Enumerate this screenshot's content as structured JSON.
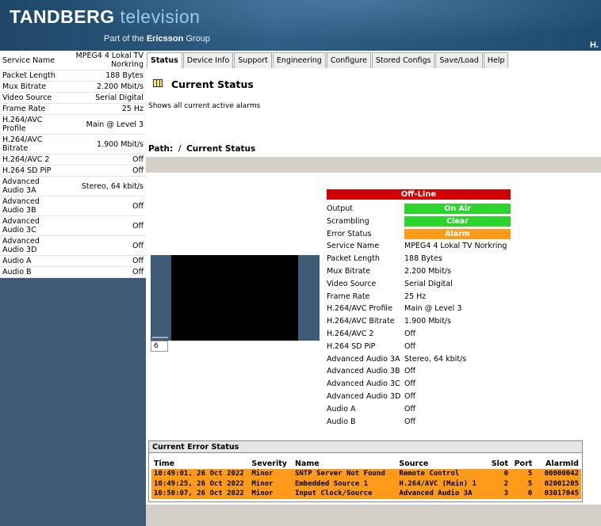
{
  "header": {
    "logo_bold": "TANDBERG",
    "logo_light": " television",
    "tagline_prefix": "Part of the",
    "tagline_company": "Ericsson",
    "tagline_suffix": "Group",
    "corner_text": "H."
  },
  "sidebar": {
    "rows": [
      {
        "label": "Service Name",
        "value": "MPEG4 4 Lokal TV Norkring"
      },
      {
        "label": "Packet Length",
        "value": "188 Bytes"
      },
      {
        "label": "Mux Bitrate",
        "value": "2.200 Mbit/s"
      },
      {
        "label": "Video Source",
        "value": "Serial Digital"
      },
      {
        "label": "Frame Rate",
        "value": "25 Hz"
      },
      {
        "label": "H.264/AVC Profile",
        "value": "Main @ Level 3"
      },
      {
        "label": "H.264/AVC Bitrate",
        "value": "1.900 Mbit/s"
      },
      {
        "label": "H.264/AVC 2",
        "value": "Off"
      },
      {
        "label": "H.264 SD PiP",
        "value": "Off"
      },
      {
        "label": "Advanced Audio 3A",
        "value": "Stereo, 64 kbit/s"
      },
      {
        "label": "Advanced Audio 3B",
        "value": "Off"
      },
      {
        "label": "Advanced Audio 3C",
        "value": "Off"
      },
      {
        "label": "Advanced Audio 3D",
        "value": "Off"
      },
      {
        "label": "Audio A",
        "value": "Off"
      },
      {
        "label": "Audio B",
        "value": "Off"
      }
    ]
  },
  "tabs": [
    {
      "label": "Status",
      "active": true
    },
    {
      "label": "Device Info"
    },
    {
      "label": "Support"
    },
    {
      "label": "Engineering"
    },
    {
      "label": "Configure"
    },
    {
      "label": "Stored Configs"
    },
    {
      "label": "Save/Load"
    },
    {
      "label": "Help"
    }
  ],
  "main": {
    "title": "Current Status",
    "description": "Shows all current active alarms",
    "path_label": "Path:",
    "path_sep": "/",
    "path_current": "Current Status"
  },
  "status": {
    "offline": "Off-Line",
    "output_label": "Output",
    "output_value": "On Air",
    "scrambling_label": "Scrambling",
    "scrambling_value": "Clear",
    "error_label": "Error Status",
    "error_value": "Alarm",
    "colors": {
      "offline": "#d40000",
      "ok": "#2dd42d",
      "alarm": "#ff9a1a"
    },
    "details": [
      {
        "label": "Service Name",
        "value": "MPEG4 4 Lokal TV Norkring"
      },
      {
        "label": "Packet Length",
        "value": "188 Bytes"
      },
      {
        "label": "Mux Bitrate",
        "value": "2.200 Mbit/s"
      },
      {
        "label": "Video Source",
        "value": "Serial Digital"
      },
      {
        "label": "Frame Rate",
        "value": "25 Hz"
      },
      {
        "label": "H.264/AVC Profile",
        "value": "Main @ Level 3"
      },
      {
        "label": "H.264/AVC Bitrate",
        "value": "1.900 Mbit/s"
      },
      {
        "label": "H.264/AVC 2",
        "value": "Off"
      },
      {
        "label": "H.264 SD PiP",
        "value": "Off"
      },
      {
        "label": "Advanced Audio 3A",
        "value": "Stereo, 64 kbit/s"
      },
      {
        "label": "Advanced Audio 3B",
        "value": "Off"
      },
      {
        "label": "Advanced Audio 3C",
        "value": "Off"
      },
      {
        "label": "Advanced Audio 3D",
        "value": "Off"
      },
      {
        "label": "Audio A",
        "value": "Off"
      },
      {
        "label": "Audio B",
        "value": "Off"
      }
    ]
  },
  "video": {
    "channel": "6"
  },
  "errors": {
    "title": "Current Error Status",
    "columns": [
      "Time",
      "Severity",
      "Name",
      "Source",
      "Slot",
      "Port",
      "AlarmId"
    ],
    "rows": [
      {
        "time": "10:49:01, 26 Oct 2022",
        "severity": "Minor",
        "name": "SNTP Server Not Found",
        "source": "Remote Control",
        "slot": "0",
        "port": "5",
        "alarm_id": "00000042"
      },
      {
        "time": "10:49:25, 26 Oct 2022",
        "severity": "Minor",
        "name": "Embedded Source 1",
        "source": "H.264/AVC (Main) 1",
        "slot": "2",
        "port": "5",
        "alarm_id": "02001205"
      },
      {
        "time": "10:50:07, 26 Oct 2022",
        "severity": "Minor",
        "name": "Input Clock/Source",
        "source": "Advanced Audio 3A",
        "slot": "3",
        "port": "0",
        "alarm_id": "03017045"
      }
    ]
  }
}
